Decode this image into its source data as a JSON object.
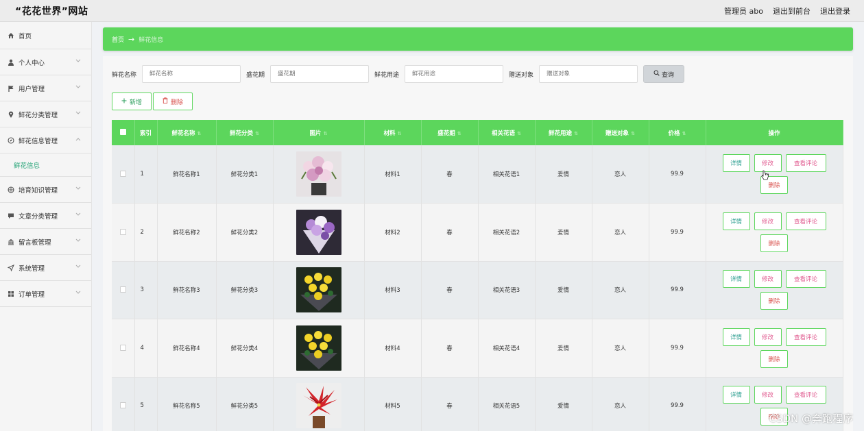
{
  "header": {
    "brand": "“花花世界”网站",
    "admin": "管理员 abo",
    "to_frontend": "退出到前台",
    "logout": "退出登录"
  },
  "sidebar": {
    "items": [
      {
        "label": "首页",
        "icon": "home-icon"
      },
      {
        "label": "个人中心",
        "icon": "user-icon"
      },
      {
        "label": "用户管理",
        "icon": "flag-icon"
      },
      {
        "label": "鲜花分类管理",
        "icon": "location-icon"
      },
      {
        "label": "鲜花信息管理",
        "icon": "compass-icon",
        "expanded": true
      },
      {
        "label": "培育知识管理",
        "icon": "globe-icon"
      },
      {
        "label": "文章分类管理",
        "icon": "chat-icon"
      },
      {
        "label": "留言板管理",
        "icon": "bank-icon"
      },
      {
        "label": "系统管理",
        "icon": "send-icon"
      },
      {
        "label": "订单管理",
        "icon": "grid-icon"
      }
    ],
    "submenu_active": "鲜花信息"
  },
  "breadcrumb": {
    "home": "首页",
    "arrow": "→",
    "current": "鲜花信息"
  },
  "filters": {
    "name_label": "鲜花名称",
    "name_placeholder": "鲜花名称",
    "season_label": "盛花期",
    "season_placeholder": "盛花期",
    "use_label": "鲜花用途",
    "use_placeholder": "鲜花用途",
    "target_label": "赠送对象",
    "target_placeholder": "赠送对象",
    "search_button": "查询"
  },
  "toolbar": {
    "add_label": "新增",
    "delete_label": "删除"
  },
  "table": {
    "columns": [
      "索引",
      "鲜花名称",
      "鲜花分类",
      "图片",
      "材料",
      "盛花期",
      "相关花语",
      "鲜花用途",
      "赠送对象",
      "价格",
      "操作"
    ],
    "rows": [
      {
        "index": "1",
        "name": "鲜花名称1",
        "category": "鲜花分类1",
        "material": "材料1",
        "season": "春",
        "language": "相关花语1",
        "use": "爱情",
        "target": "恋人",
        "price": "99.9"
      },
      {
        "index": "2",
        "name": "鲜花名称2",
        "category": "鲜花分类2",
        "material": "材料2",
        "season": "春",
        "language": "相关花语2",
        "use": "爱情",
        "target": "恋人",
        "price": "99.9"
      },
      {
        "index": "3",
        "name": "鲜花名称3",
        "category": "鲜花分类3",
        "material": "材料3",
        "season": "春",
        "language": "相关花语3",
        "use": "爱情",
        "target": "恋人",
        "price": "99.9"
      },
      {
        "index": "4",
        "name": "鲜花名称4",
        "category": "鲜花分类4",
        "material": "材料4",
        "season": "春",
        "language": "相关花语4",
        "use": "爱情",
        "target": "恋人",
        "price": "99.9"
      },
      {
        "index": "5",
        "name": "鲜花名称5",
        "category": "鲜花分类5",
        "material": "材料5",
        "season": "春",
        "language": "相关花语5",
        "use": "爱情",
        "target": "恋人",
        "price": "99.9"
      }
    ],
    "op_labels": {
      "detail": "详情",
      "edit": "修改",
      "review": "查看评论",
      "delete": "删除"
    }
  },
  "watermark": "CSDN @奔跑程序",
  "colors": {
    "accent": "#5cd65c",
    "link": "#2aa67a",
    "danger": "#d9534f"
  }
}
